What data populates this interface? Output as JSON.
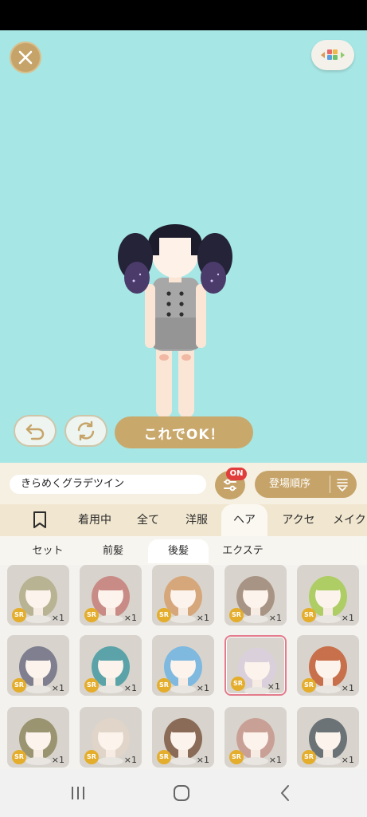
{
  "outfit": {
    "ok_label": "これでOK！"
  },
  "search": {
    "item_name": "きらめくグラデツイン",
    "filter_badge": "ON",
    "sort_label": "登場順序"
  },
  "tabs": [
    {
      "label": "着用中"
    },
    {
      "label": "全て"
    },
    {
      "label": "洋服"
    },
    {
      "label": "ヘア",
      "active": true
    },
    {
      "label": "アクセ"
    },
    {
      "label": "メイク"
    }
  ],
  "subtabs": [
    {
      "label": "セット"
    },
    {
      "label": "前髪"
    },
    {
      "label": "後髪",
      "active": true
    },
    {
      "label": "エクステ"
    }
  ],
  "items": [
    {
      "rarity": "SR",
      "quantity": "×1",
      "hair_color": "#b8b393"
    },
    {
      "rarity": "SR",
      "quantity": "×1",
      "hair_color": "#c98b86"
    },
    {
      "rarity": "SR",
      "quantity": "×1",
      "hair_color": "#d7a77c"
    },
    {
      "rarity": "SR",
      "quantity": "×1",
      "hair_color": "#a89485"
    },
    {
      "rarity": "SR",
      "quantity": "×1",
      "hair_color": "#aecd64"
    },
    {
      "rarity": "SR",
      "quantity": "×1",
      "hair_color": "#7f7f90"
    },
    {
      "rarity": "SR",
      "quantity": "×1",
      "hair_color": "#5ba3a8"
    },
    {
      "rarity": "SR",
      "quantity": "×1",
      "hair_color": "#7fb9df"
    },
    {
      "rarity": "SR",
      "quantity": "×1",
      "hair_color": "#d9d0dc",
      "selected": true
    },
    {
      "rarity": "SR",
      "quantity": "×1",
      "hair_color": "#c7704b"
    },
    {
      "rarity": "SR",
      "quantity": "×1",
      "hair_color": "#9a9471"
    },
    {
      "rarity": "SR",
      "quantity": "×1",
      "hair_color": "#e0d5c8"
    },
    {
      "rarity": "SR",
      "quantity": "×1",
      "hair_color": "#8a6b57"
    },
    {
      "rarity": "SR",
      "quantity": "×1",
      "hair_color": "#c9a096"
    },
    {
      "rarity": "SR",
      "quantity": "×1",
      "hair_color": "#6c7377"
    }
  ],
  "colors": {
    "stage_background": "#a6e6e4",
    "accent_gold": "#c6a469",
    "badge_red": "#e23d3d",
    "selected_border": "#e37b8c"
  },
  "icons": {
    "close": "close-icon",
    "palette": "palette-icon",
    "undo": "undo-icon",
    "rotate": "rotate-icon",
    "filter": "filter-icon",
    "sort": "sort-icon",
    "bookmark": "bookmark-icon",
    "nav_recent": "recent-apps-icon",
    "nav_home": "home-icon",
    "nav_back": "back-icon"
  }
}
